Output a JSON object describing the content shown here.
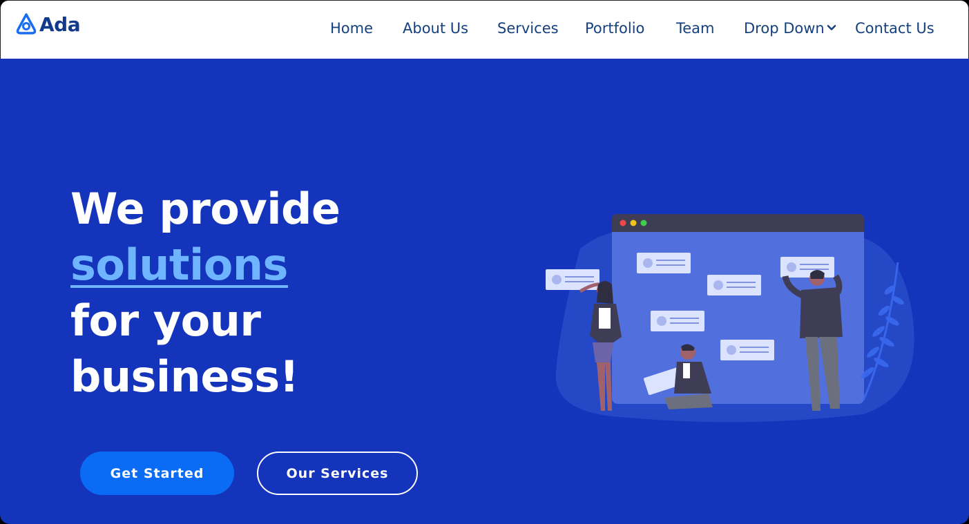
{
  "brand": {
    "name": "Ada",
    "logo_icon": "ada-logo-icon",
    "color": "#113b8a"
  },
  "nav": {
    "items": [
      {
        "label": "Home"
      },
      {
        "label": "About Us"
      },
      {
        "label": "Services"
      },
      {
        "label": "Portfolio"
      },
      {
        "label": "Team"
      },
      {
        "label": "Drop Down",
        "icon": "chevron-down-icon"
      },
      {
        "label": "Contact Us"
      }
    ],
    "color": "#14407f"
  },
  "hero": {
    "line1": "We provide",
    "line2": "solutions",
    "line3": "for your",
    "line4": "business!",
    "accent_color": "#6fb4ff",
    "background": "#1434bb"
  },
  "buttons": {
    "primary": {
      "label": "Get Started",
      "color": "#0a6cf5"
    },
    "secondary": {
      "label": "Our Services"
    }
  },
  "illustration": {
    "icon": "team-collaboration-illustration"
  }
}
